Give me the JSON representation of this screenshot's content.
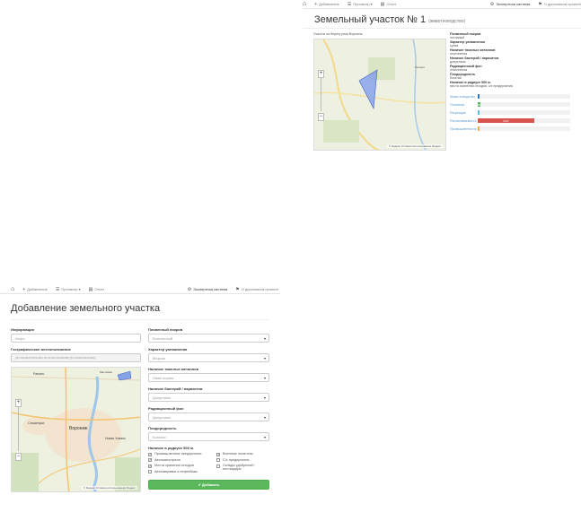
{
  "colors": {
    "accent": "#337ab7",
    "success": "#5cb85c",
    "danger": "#d9534f",
    "link": "#5b9bd5",
    "polygon": "#6a8fe8"
  },
  "top_view": {
    "nav": {
      "add": "Добавление",
      "view": "Просмотр",
      "report": "Отчет",
      "expert": "Экспертная система",
      "about": "О дипломном проекте"
    },
    "title": "Земельный участок № 1",
    "subtitle": "(животноводство)",
    "location": "Участок на берегу реки Воронеж",
    "map_footer": "© Яндекс  Условия использования  Яндекс",
    "map_label": "Рыбное",
    "properties": [
      {
        "label": "Почвенный покров",
        "value": "песчаный"
      },
      {
        "label": "Характер увлажнения",
        "value": "сухая"
      },
      {
        "label": "Наличие тяжелых металлов",
        "value": "отклонения"
      },
      {
        "label": "Наличие бактерий / паразитов",
        "value": "допустимо"
      },
      {
        "label": "Радиационный фон",
        "value": "отклонения"
      },
      {
        "label": "Плодородность",
        "value": "богатая"
      },
      {
        "label": "Наличие в радиусе 500 м.",
        "value": "места хранения отходов, с/х предприятия"
      }
    ],
    "stats": [
      {
        "name": "Животноводство",
        "value": 1,
        "color": "#337ab7",
        "label": ""
      },
      {
        "name": "Посевная",
        "value": 3,
        "color": "#5cb85c",
        "label": "3%"
      },
      {
        "name": "Рекреация",
        "value": 1,
        "color": "#5bc0de",
        "label": ""
      },
      {
        "name": "Распахиваемость",
        "value": 61,
        "color": "#d9534f",
        "label": "61%"
      },
      {
        "name": "Промышленность",
        "value": 1,
        "color": "#f0ad4e",
        "label": ""
      }
    ]
  },
  "bottom_view": {
    "nav": {
      "add": "Добавление",
      "view": "Просмотр",
      "report": "Отчет",
      "expert": "Экспертная система",
      "about": "О дипломном проекте"
    },
    "title": "Добавление земельного участка",
    "info_label": "Информация",
    "info_placeholder": "Инфо",
    "geo_label": "Географическое местоположение",
    "geo_value": "[[51.620094978191969,39.36139709425086],[51.6058145331289]]",
    "map_labels": {
      "voronezh": "Воронеж",
      "semiluki": "Семилуки",
      "novaya_usman": "Новая Усмань",
      "ramon": "Рамонь",
      "mazutnyy": "Масловка"
    },
    "map_footer": "© Яндекс  Условия использования  Яндекс",
    "fields": [
      {
        "label": "Почвенный покров",
        "value": "Болотистый"
      },
      {
        "label": "Характер увлажнения",
        "value": "Мокрая"
      },
      {
        "label": "Наличие тяжелых металлов",
        "value": "Ниже нормы"
      },
      {
        "label": "Наличие бактерий / паразитов",
        "value": "Допустимо"
      },
      {
        "label": "Радиационный фон",
        "value": "Допустимо"
      },
      {
        "label": "Плодородность",
        "value": "Богатая"
      }
    ],
    "radius_label": "Наличие в радиусе 500 м.",
    "checks_left": [
      {
        "label": "Промышленные предприятия",
        "checked": true
      },
      {
        "label": "Автомагистрали",
        "checked": true
      },
      {
        "label": "Места хранения отходов",
        "checked": true
      },
      {
        "label": "Автозаправки и нефтебазы",
        "checked": false
      }
    ],
    "checks_right": [
      {
        "label": "Военные полигоны",
        "checked": true
      },
      {
        "label": "С/х предприятия",
        "checked": false
      },
      {
        "label": "Склады удобрений / пестицидов",
        "checked": false
      }
    ],
    "submit": "✔ Добавить"
  }
}
